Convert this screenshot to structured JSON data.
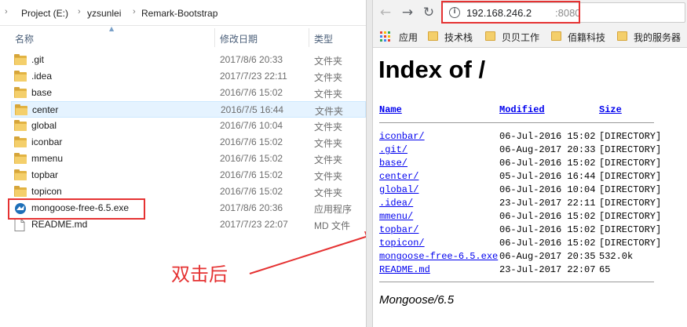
{
  "explorer": {
    "breadcrumb": [
      "Project (E:)",
      "yzsunlei",
      "Remark-Bootstrap"
    ],
    "columns": {
      "name": "名称",
      "date": "修改日期",
      "type": "类型"
    },
    "rows": [
      {
        "name": ".git",
        "date": "2017/8/6 20:33",
        "type": "文件夹",
        "icon": "folder-icon"
      },
      {
        "name": ".idea",
        "date": "2017/7/23 22:11",
        "type": "文件夹",
        "icon": "folder-icon"
      },
      {
        "name": "base",
        "date": "2016/7/6 15:02",
        "type": "文件夹",
        "icon": "folder-icon"
      },
      {
        "name": "center",
        "date": "2016/7/5 16:44",
        "type": "文件夹",
        "icon": "folder-icon",
        "selected": true
      },
      {
        "name": "global",
        "date": "2016/7/6 10:04",
        "type": "文件夹",
        "icon": "folder-icon"
      },
      {
        "name": "iconbar",
        "date": "2016/7/6 15:02",
        "type": "文件夹",
        "icon": "folder-icon"
      },
      {
        "name": "mmenu",
        "date": "2016/7/6 15:02",
        "type": "文件夹",
        "icon": "folder-icon"
      },
      {
        "name": "topbar",
        "date": "2016/7/6 15:02",
        "type": "文件夹",
        "icon": "folder-icon"
      },
      {
        "name": "topicon",
        "date": "2016/7/6 15:02",
        "type": "文件夹",
        "icon": "folder-icon"
      },
      {
        "name": "mongoose-free-6.5.exe",
        "date": "2017/8/6 20:36",
        "type": "应用程序",
        "icon": "mongoose-app-icon"
      },
      {
        "name": "README.md",
        "date": "2017/7/23 22:07",
        "type": "MD 文件",
        "icon": "file-icon"
      }
    ],
    "annotation": "双击后",
    "highlight_color": "#e53232"
  },
  "browser": {
    "url_host": "192.168.246.2",
    "url_port": ":8080",
    "bookmarks": [
      {
        "label": "应用",
        "icon": "apps-grid-icon"
      },
      {
        "label": "技术栈",
        "icon": "folder-icon"
      },
      {
        "label": "贝贝工作",
        "icon": "folder-icon"
      },
      {
        "label": "佰籍科技",
        "icon": "folder-icon"
      },
      {
        "label": "我的服务器",
        "icon": "folder-icon"
      }
    ],
    "page": {
      "title": "Index of /",
      "headers": {
        "name": "Name",
        "modified": "Modified",
        "size": "Size"
      },
      "entries": [
        {
          "name": "iconbar/",
          "modified": "06-Jul-2016 15:02",
          "size": "[DIRECTORY]"
        },
        {
          "name": ".git/",
          "modified": "06-Aug-2017 20:33",
          "size": "[DIRECTORY]"
        },
        {
          "name": "base/",
          "modified": "06-Jul-2016 15:02",
          "size": "[DIRECTORY]"
        },
        {
          "name": "center/",
          "modified": "05-Jul-2016 16:44",
          "size": "[DIRECTORY]"
        },
        {
          "name": "global/",
          "modified": "06-Jul-2016 10:04",
          "size": "[DIRECTORY]"
        },
        {
          "name": ".idea/",
          "modified": "23-Jul-2017 22:11",
          "size": "[DIRECTORY]"
        },
        {
          "name": "mmenu/",
          "modified": "06-Jul-2016 15:02",
          "size": "[DIRECTORY]"
        },
        {
          "name": "topbar/",
          "modified": "06-Jul-2016 15:02",
          "size": "[DIRECTORY]"
        },
        {
          "name": "topicon/",
          "modified": "06-Jul-2016 15:02",
          "size": "[DIRECTORY]"
        },
        {
          "name": "mongoose-free-6.5.exe",
          "modified": "06-Aug-2017 20:35",
          "size": "532.0k"
        },
        {
          "name": "README.md",
          "modified": "23-Jul-2017 22:07",
          "size": "65"
        }
      ],
      "footer": "Mongoose/6.5"
    }
  }
}
